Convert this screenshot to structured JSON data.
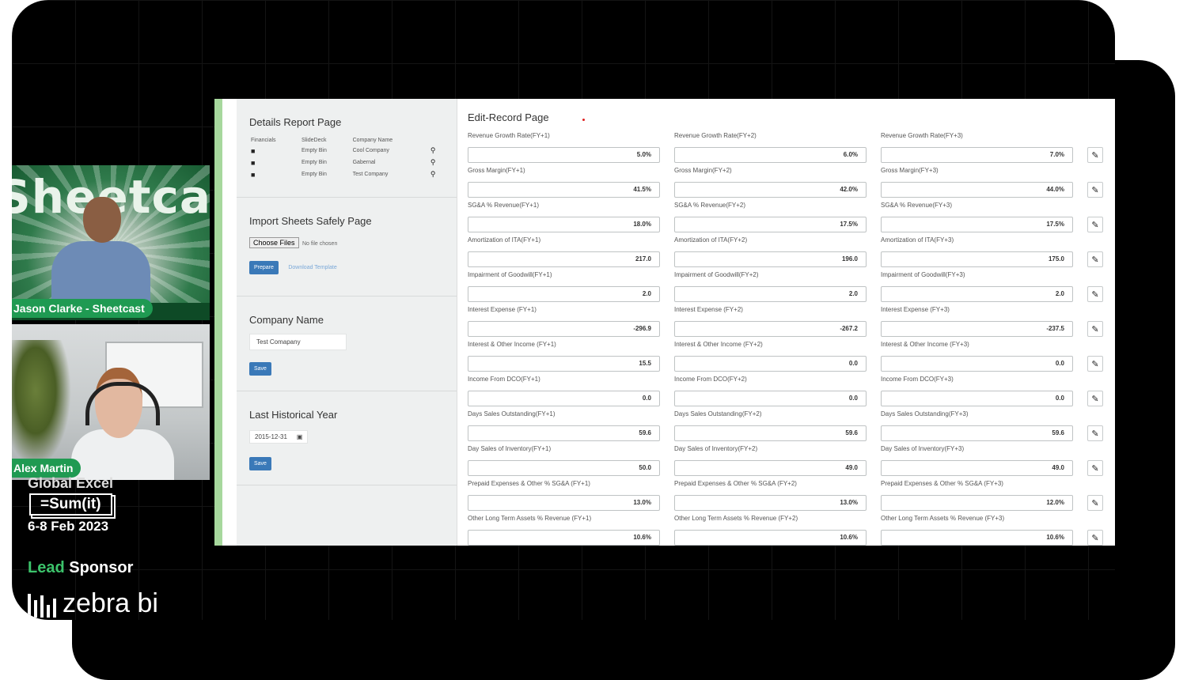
{
  "participants": [
    {
      "name": "Jason Clarke - Sheetcast",
      "background_word": "Sheetcast"
    },
    {
      "name": "Alex Martin"
    }
  ],
  "event": {
    "title": "Global Excel",
    "logo": "=Sum(it)",
    "dates": "6-8 Feb 2023",
    "lead_prefix": "Lead",
    "lead_suffix": " Sponsor",
    "sponsor": "zebra bi"
  },
  "colors": {
    "accent_green": "#3cc36b",
    "button_blue": "#3a79b8"
  },
  "left_panel": {
    "details": {
      "title": "Details Report Page",
      "headers": [
        "Financials",
        "SlideDeck",
        "Company Name"
      ],
      "rows": [
        {
          "icon": "pdf-icon",
          "deck": "Empty Bin",
          "company": "Cool Company",
          "action": "search-icon"
        },
        {
          "icon": "pdf-icon",
          "deck": "Empty Bin",
          "company": "Gabernal",
          "action": "search-icon"
        },
        {
          "icon": "pdf-icon",
          "deck": "Empty Bin",
          "company": "Test Company",
          "action": "search-icon"
        }
      ]
    },
    "import": {
      "title": "Import Sheets Safely Page",
      "choose_files": "Choose Files",
      "no_file": "No file chosen",
      "prepare": "Prepare",
      "download": "Download Template"
    },
    "company": {
      "title": "Company Name",
      "value": "Test Comapany",
      "save": "Save"
    },
    "history": {
      "title": "Last Historical Year",
      "value": "2015-12-31",
      "save": "Save"
    }
  },
  "edit_record": {
    "title": "Edit-Record Page",
    "rows": [
      {
        "labels": [
          "Revenue Growth Rate(FY+1)",
          "Revenue Growth Rate(FY+2)",
          "Revenue Growth Rate(FY+3)"
        ],
        "values": [
          "5.0%",
          "6.0%",
          "7.0%"
        ]
      },
      {
        "labels": [
          "Gross Margin(FY+1)",
          "Gross Margin(FY+2)",
          "Gross Margin(FY+3)"
        ],
        "values": [
          "41.5%",
          "42.0%",
          "44.0%"
        ]
      },
      {
        "labels": [
          "SG&A % Revenue(FY+1)",
          "SG&A % Revenue(FY+2)",
          "SG&A % Revenue(FY+3)"
        ],
        "values": [
          "18.0%",
          "17.5%",
          "17.5%"
        ]
      },
      {
        "labels": [
          "Amortization of ITA(FY+1)",
          "Amortization of ITA(FY+2)",
          "Amortization of ITA(FY+3)"
        ],
        "values": [
          "217.0",
          "196.0",
          "175.0"
        ]
      },
      {
        "labels": [
          "Impairment of Goodwill(FY+1)",
          "Impairment of Goodwill(FY+2)",
          "Impairment of Goodwill(FY+3)"
        ],
        "values": [
          "2.0",
          "2.0",
          "2.0"
        ]
      },
      {
        "labels": [
          "Interest Expense (FY+1)",
          "Interest Expense (FY+2)",
          "Interest Expense (FY+3)"
        ],
        "values": [
          "-296.9",
          "-267.2",
          "-237.5"
        ]
      },
      {
        "labels": [
          "Interest & Other Income (FY+1)",
          "Interest & Other Income (FY+2)",
          "Interest & Other Income (FY+3)"
        ],
        "values": [
          "15.5",
          "0.0",
          "0.0"
        ]
      },
      {
        "labels": [
          "Income From DCO(FY+1)",
          "Income From DCO(FY+2)",
          "Income From DCO(FY+3)"
        ],
        "values": [
          "0.0",
          "0.0",
          "0.0"
        ]
      },
      {
        "labels": [
          "Days Sales Outstanding(FY+1)",
          "Days Sales Outstanding(FY+2)",
          "Days Sales Outstanding(FY+3)"
        ],
        "values": [
          "59.6",
          "59.6",
          "59.6"
        ]
      },
      {
        "labels": [
          "Day Sales of Inventory(FY+1)",
          "Day Sales of Inventory(FY+2)",
          "Day Sales of Inventory(FY+3)"
        ],
        "values": [
          "50.0",
          "49.0",
          "49.0"
        ]
      },
      {
        "labels": [
          "Prepaid Expenses & Other % SG&A (FY+1)",
          "Prepaid Expenses & Other % SG&A (FY+2)",
          "Prepaid Expenses & Other % SG&A (FY+3)"
        ],
        "values": [
          "13.0%",
          "13.0%",
          "12.0%"
        ]
      },
      {
        "labels": [
          "Other Long Term Assets % Revenue (FY+1)",
          "Other Long Term Assets % Revenue (FY+2)",
          "Other Long Term Assets % Revenue (FY+3)"
        ],
        "values": [
          "10.6%",
          "10.6%",
          "10.6%"
        ]
      }
    ],
    "edit_icon": "pencil-icon"
  }
}
